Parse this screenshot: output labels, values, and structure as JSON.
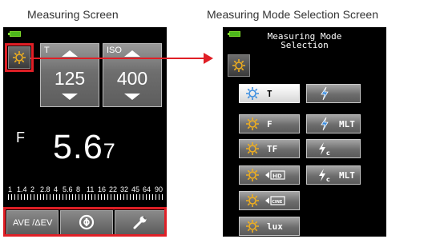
{
  "captions": {
    "left": "Measuring Screen",
    "right": "Measuring Mode Selection Screen"
  },
  "measuring": {
    "mode_icon": "sun-icon",
    "shutter": {
      "label": "T",
      "value": "125"
    },
    "iso": {
      "label": "ISO",
      "value": "400"
    },
    "aperture": {
      "label": "F",
      "value": "5.6",
      "subvalue": "7"
    },
    "scale": [
      "1",
      "1.4",
      "2",
      "2.8",
      "4",
      "5.6",
      "8",
      "11",
      "16",
      "22",
      "32",
      "45",
      "64",
      "90"
    ],
    "bottom": {
      "ave_label": "AVE /ΔEV",
      "memory_icon": "memory-icon",
      "settings_icon": "wrench-icon"
    }
  },
  "selection": {
    "title_line1": "Measuring Mode",
    "title_line2": "Selection",
    "mode_icon": "sun-icon",
    "modes": [
      {
        "icon": "sun-icon",
        "label": "T",
        "selected": true
      },
      {
        "icon": "flash-icon",
        "label": ""
      },
      {
        "icon": "sun-icon",
        "label": "F"
      },
      {
        "icon": "flash-icon",
        "label": "MLT"
      },
      {
        "icon": "sun-icon",
        "label": "TF"
      },
      {
        "icon": "flash-cumulative-icon",
        "label": ""
      },
      {
        "icon": "sun-hd-icon",
        "label": ""
      },
      {
        "icon": "flash-cumulative-icon",
        "label": "MLT"
      },
      {
        "icon": "sun-cine-icon",
        "label": ""
      },
      {
        "icon": "sun-icon",
        "label": "lux"
      }
    ]
  }
}
